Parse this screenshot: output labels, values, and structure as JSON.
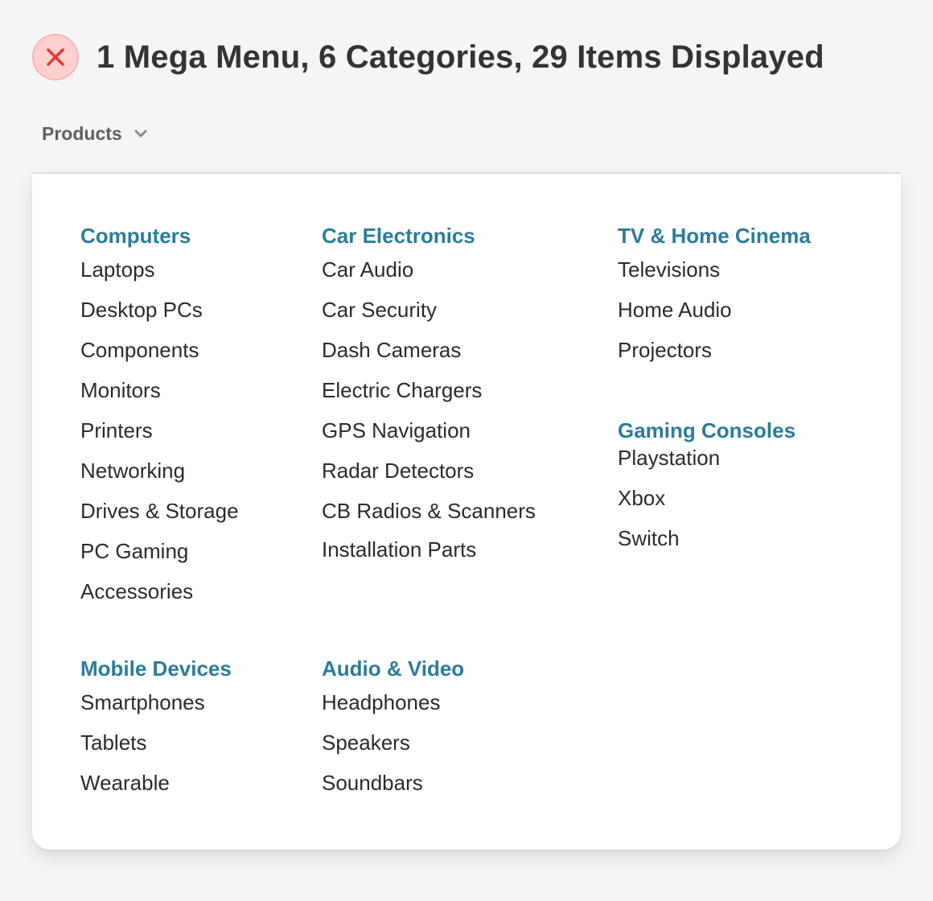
{
  "header": {
    "status_icon": "close-x-icon",
    "status_color": "#e53935",
    "title": "1 Mega Menu, 6 Categories, 29 Items Displayed"
  },
  "menu": {
    "trigger_label": "Products",
    "trigger_icon": "chevron-down-icon",
    "accent_color": "#2b7c99",
    "categories": [
      {
        "title": "Computers",
        "items": [
          "Laptops",
          "Desktop PCs",
          "Components",
          "Monitors",
          "Printers",
          "Networking",
          "Drives & Storage",
          "PC Gaming",
          "Accessories"
        ]
      },
      {
        "title": "Car Electronics",
        "items": [
          "Car Audio",
          "Car Security",
          "Dash Cameras",
          "Electric Chargers",
          "GPS Navigation",
          "Radar Detectors",
          "CB Radios & Scanners",
          "Installation Parts"
        ]
      },
      {
        "title": "TV & Home Cinema",
        "items": [
          "Televisions",
          "Home Audio",
          "Projectors"
        ]
      },
      {
        "title": "Gaming Consoles",
        "items": [
          "Playstation",
          "Xbox",
          "Switch"
        ]
      },
      {
        "title": "Mobile Devices",
        "items": [
          "Smartphones",
          "Tablets",
          "Wearable"
        ]
      },
      {
        "title": "Audio & Video",
        "items": [
          "Headphones",
          "Speakers",
          "Soundbars"
        ]
      }
    ]
  }
}
